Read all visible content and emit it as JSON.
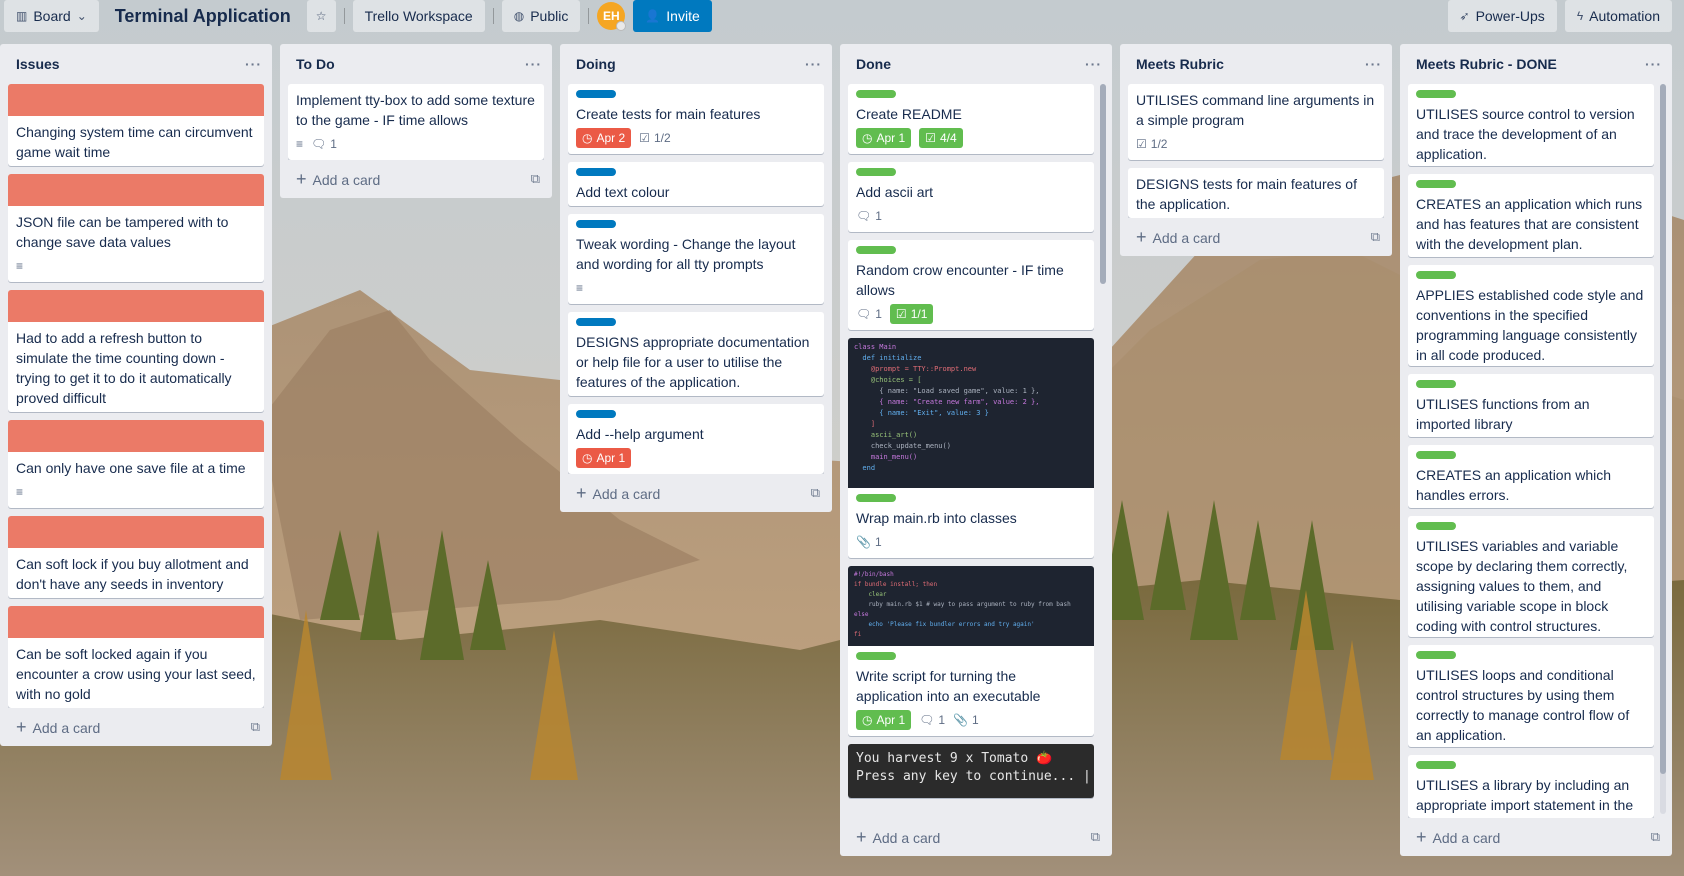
{
  "topbar": {
    "board_view_label": "Board",
    "board_title": "Terminal Application",
    "workspace_label": "Trello Workspace",
    "visibility_label": "Public",
    "avatar_initials": "EH",
    "invite_label": "Invite",
    "powerups_label": "Power-Ups",
    "automation_label": "Automation"
  },
  "add_card_label": "Add a card",
  "lists": [
    {
      "title": "Issues",
      "cards": [
        {
          "text": "Changing system time can circumvent game wait time"
        },
        {
          "text": "JSON file can be tampered with to change save data values",
          "description": true
        },
        {
          "text": "Had to add a refresh button to simulate the time counting down - trying to get it to do it automatically proved difficult"
        },
        {
          "text": "Can only have one save file at a time",
          "description": true
        },
        {
          "text": "Can soft lock if you buy allotment and don't have any seeds in inventory"
        },
        {
          "text": "Can be soft locked again if you encounter a crow using your last seed, with no gold"
        }
      ]
    },
    {
      "title": "To Do",
      "cards": [
        {
          "text": "Implement tty-box to add some texture to the game - IF time allows",
          "comments": "1"
        }
      ]
    },
    {
      "title": "Doing",
      "cards": [
        {
          "text": "Create tests for main features",
          "due": "Apr 2",
          "checklist": "1/2"
        },
        {
          "text": "Add text colour"
        },
        {
          "text": "Tweak wording - Change the layout and wording for all tty prompts"
        },
        {
          "text": "DESIGNS appropriate documentation or help file for a user to utilise the features of the application."
        },
        {
          "text": "Add --help argument",
          "due": "Apr 1"
        }
      ]
    },
    {
      "title": "Done",
      "cards": [
        {
          "text": "Create README",
          "due": "Apr 1",
          "checklist": "4/4"
        },
        {
          "text": "Add ascii art",
          "comments": "1"
        },
        {
          "text": "Random crow encounter - IF time allows",
          "comments": "1",
          "checklist": "1/1"
        },
        {
          "text": "Wrap main.rb into classes",
          "attachments": "1"
        },
        {
          "text": "Write script for turning the application into an executable",
          "due": "Apr 1",
          "comments": "1",
          "attachments": "1"
        },
        {
          "text": "You harvest 9 x Tomato 🍅\nPress any key to continue... |"
        }
      ]
    },
    {
      "title": "Meets Rubric",
      "cards": [
        {
          "text": "UTILISES command line arguments in a simple program",
          "checklist": "1/2"
        },
        {
          "text": "DESIGNS tests for main features of the application."
        }
      ]
    },
    {
      "title": "Meets Rubric - DONE",
      "cards": [
        {
          "text": "UTILISES source control to version and trace the development of an application."
        },
        {
          "text": "CREATES an application which runs and has features that are consistent with the development plan."
        },
        {
          "text": "APPLIES established code style and conventions in the specified programming language consistently in all code produced."
        },
        {
          "text": "UTILISES functions from an imported library"
        },
        {
          "text": "CREATES an application which handles errors."
        },
        {
          "text": "UTILISES variables and variable scope by declaring them correctly, assigning values to them, and utilising variable scope in block coding with control structures."
        },
        {
          "text": "UTILISES loops and conditional control structures by using them correctly to manage control flow of an application."
        },
        {
          "text": "UTILISES a library by including an appropriate import statement in the"
        }
      ]
    }
  ],
  "code_snippet_1": [
    "class Main",
    "  def initialize",
    "    @prompt = TTY::Prompt.new",
    "    @choices = [",
    "      { name: \"Load saved game\", value: 1 },",
    "      { name: \"Create new farm\", value: 2 },",
    "      { name: \"Exit\", value: 3 }",
    "    ]",
    "    ascii_art()",
    "    check_update_menu()",
    "    main_menu()",
    "  end"
  ],
  "code_snippet_2": [
    "#!/bin/bash",
    "",
    "if bundle install; then",
    "    clear",
    "    ruby main.rb $1 # way to pass argument to ruby from bash",
    "else",
    "    echo 'Please fix bundler errors and try again'",
    "fi"
  ],
  "colors": {
    "cover_red": "#eb7a67",
    "label_blue": "#0079bf",
    "label_green": "#61bd4f",
    "due_red": "#eb5a46",
    "invite_blue": "#0079bf"
  }
}
